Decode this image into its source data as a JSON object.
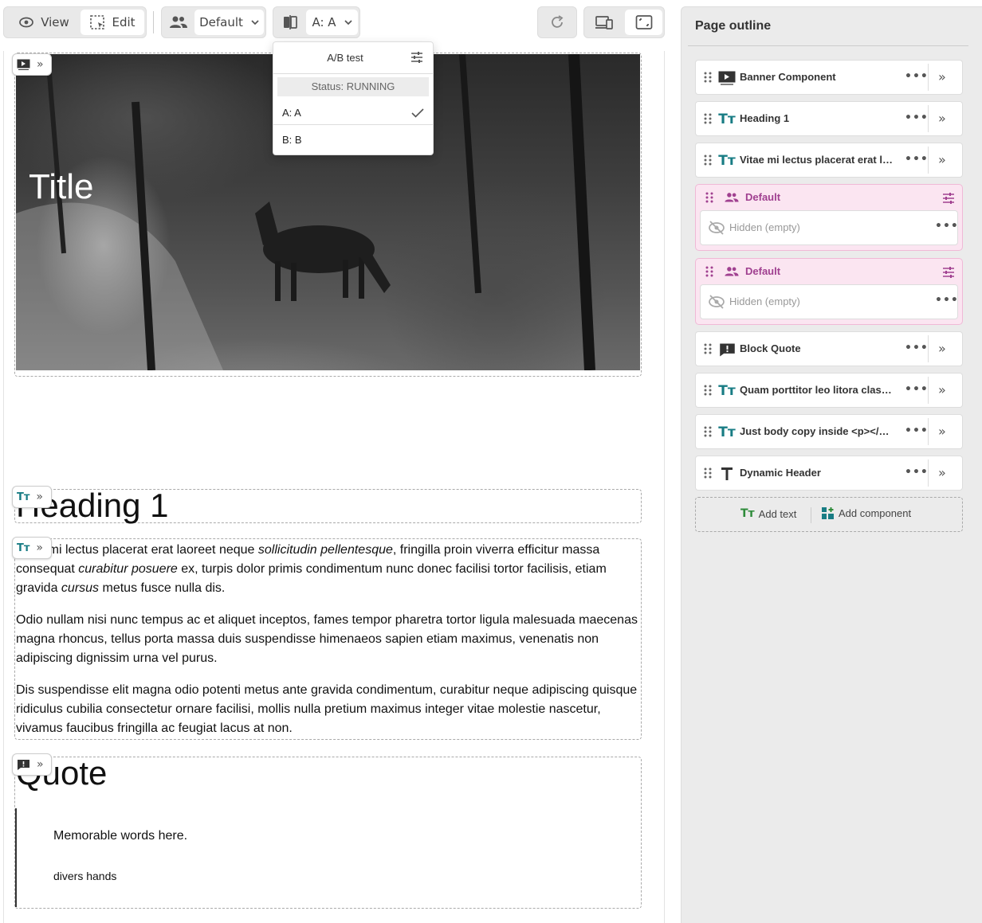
{
  "toolbar": {
    "view_label": "View",
    "edit_label": "Edit",
    "audience_label": "Default",
    "variant_label": "A: A"
  },
  "abtest": {
    "title": "A/B test",
    "status": "Status: RUNNING",
    "options": [
      {
        "label": "A: A",
        "selected": true
      },
      {
        "label": "B: B",
        "selected": false
      }
    ]
  },
  "canvas": {
    "banner_title": "Title",
    "heading": "Heading 1",
    "paragraphs": {
      "p1_a": "Vitae mi lectus placerat erat laoreet neque ",
      "p1_b": "sollicitudin pellentesque",
      "p1_c": ", fringilla proin viverra efficitur massa consequat ",
      "p1_d": "curabitur posuere",
      "p1_e": " ex, turpis dolor primis condimentum nunc donec facilisi tortor facilisis, etiam gravida ",
      "p1_f": "cursus",
      "p1_g": " metus fusce nulla dis.",
      "p2": "Odio nullam nisi nunc tempus ac et aliquet inceptos, fames tempor pharetra tortor ligula malesuada maecenas magna rhoncus, tellus porta massa duis suspendisse himenaeos sapien etiam maximus, venenatis non adipiscing dignissim urna vel purus.",
      "p3": "Dis suspendisse elit magna odio potenti metus ante gravida condimentum, curabitur neque adipiscing quisque ridiculus cubilia consectetur ornare facilisi, mollis nulla pretium maximus integer vitae molestie nascetur, vivamus faucibus fringilla ac feugiat lacus at non."
    },
    "quote_title": "Quote",
    "quote_text": "Memorable words here.",
    "quote_author": "divers hands"
  },
  "outline": {
    "title": "Page outline",
    "items": [
      {
        "label": "Banner Component",
        "icon": "banner-icon"
      },
      {
        "label": "Heading 1",
        "icon": "text-icon"
      },
      {
        "label": "Vitae mi lectus placerat erat laoreet neque",
        "icon": "text-icon"
      },
      {
        "label": "Block Quote",
        "icon": "quote-icon"
      },
      {
        "label": "Quam porttitor leo litora class aptent",
        "icon": "text-icon"
      },
      {
        "label": "Just body copy inside <p></p> tags",
        "icon": "text-icon"
      },
      {
        "label": "Dynamic Header",
        "icon": "header-icon"
      }
    ],
    "personalization": [
      {
        "label": "Default",
        "inner": "Hidden (empty)"
      },
      {
        "label": "Default",
        "inner": "Hidden (empty)"
      }
    ],
    "add_text": "Add text",
    "add_component": "Add component"
  },
  "colors": {
    "accent_teal": "#187c84",
    "personalization_pink": "#fbe5f1",
    "personalization_text": "#a04090",
    "add_green": "#2e8b3a"
  }
}
